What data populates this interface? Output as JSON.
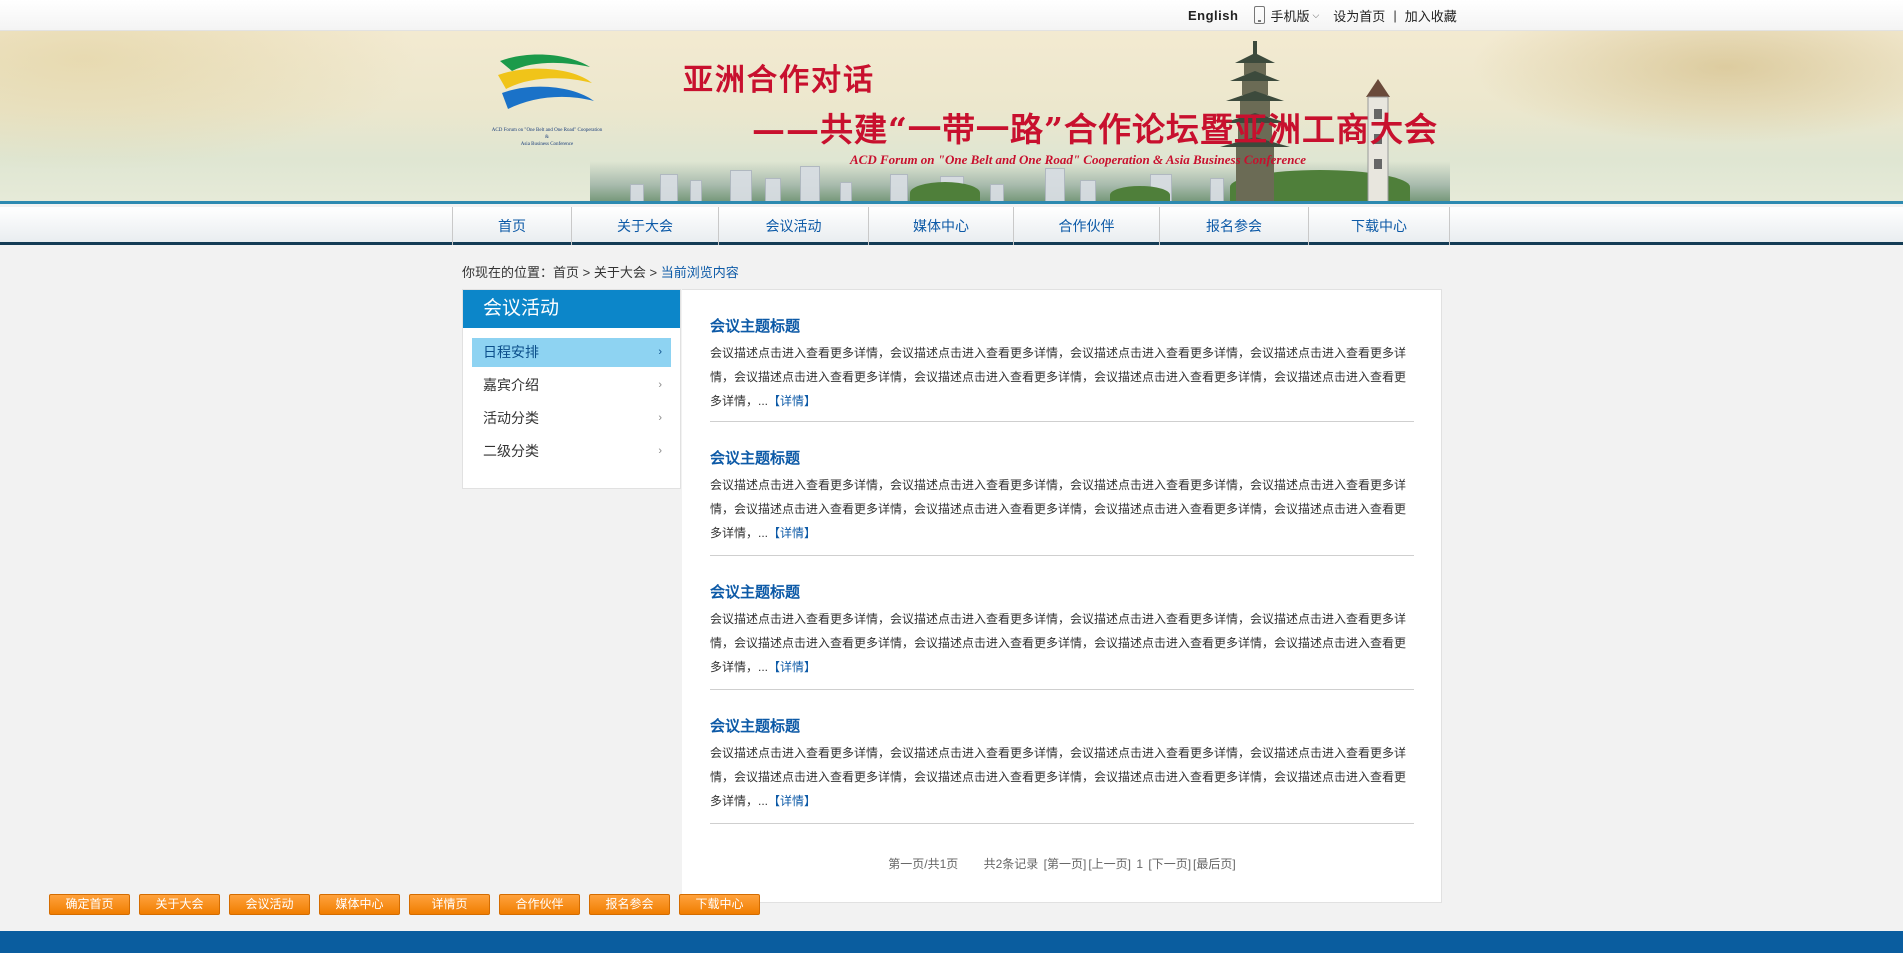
{
  "topbar": {
    "english": "English",
    "mobile": "手机版",
    "set_home": "设为首页",
    "separator": "|",
    "add_fav": "加入收藏"
  },
  "banner": {
    "logo_text_line1": "ACD Forum on \"One Belt and One Road\" Cooperation",
    "logo_text_line2": "&",
    "logo_text_line3": "Asia Business Conference",
    "title_cn_line1": "亚洲合作对话",
    "title_cn_line2": "——共建“一带一路”合作论坛暨亚洲工商大会",
    "title_en": "ACD Forum on \"One Belt and One Road\" Cooperation & Asia Business Conference"
  },
  "nav": {
    "items": [
      {
        "label": "首页"
      },
      {
        "label": "关于大会"
      },
      {
        "label": "会议活动"
      },
      {
        "label": "媒体中心"
      },
      {
        "label": "合作伙伴"
      },
      {
        "label": "报名参会"
      },
      {
        "label": "下载中心"
      }
    ]
  },
  "breadcrumb": {
    "prefix": "你现在的位置：",
    "home": "首页",
    "sep1": " > ",
    "parent": "关于大会",
    "sep2": " > ",
    "current": "当前浏览内容"
  },
  "sidebar": {
    "title": "会议活动",
    "items": [
      {
        "label": "日程安排"
      },
      {
        "label": "嘉宾介绍"
      },
      {
        "label": "活动分类"
      },
      {
        "label": "二级分类"
      }
    ]
  },
  "articles": [
    {
      "title": "会议主题标题",
      "desc": "会议描述点击进入查看更多详情，会议描述点击进入查看更多详情，会议描述点击进入查看更多详情，会议描述点击进入查看更多详情，会议描述点击进入查看更多详情，会议描述点击进入查看更多详情，会议描述点击进入查看更多详情，会议描述点击进入查看更多详情，...",
      "more": "【详情】"
    },
    {
      "title": "会议主题标题",
      "desc": "会议描述点击进入查看更多详情，会议描述点击进入查看更多详情，会议描述点击进入查看更多详情，会议描述点击进入查看更多详情，会议描述点击进入查看更多详情，会议描述点击进入查看更多详情，会议描述点击进入查看更多详情，会议描述点击进入查看更多详情，...",
      "more": "【详情】"
    },
    {
      "title": "会议主题标题",
      "desc": "会议描述点击进入查看更多详情，会议描述点击进入查看更多详情，会议描述点击进入查看更多详情，会议描述点击进入查看更多详情，会议描述点击进入查看更多详情，会议描述点击进入查看更多详情，会议描述点击进入查看更多详情，会议描述点击进入查看更多详情，...",
      "more": "【详情】"
    },
    {
      "title": "会议主题标题",
      "desc": "会议描述点击进入查看更多详情，会议描述点击进入查看更多详情，会议描述点击进入查看更多详情，会议描述点击进入查看更多详情，会议描述点击进入查看更多详情，会议描述点击进入查看更多详情，会议描述点击进入查看更多详情，会议描述点击进入查看更多详情，...",
      "more": "【详情】"
    }
  ],
  "pager": {
    "page_info": "第一页/共1页",
    "total": "共2条记录",
    "first": "[第一页]",
    "prev": "[上一页]",
    "current": "1",
    "next": "[下一页]",
    "last": "[最后页]"
  },
  "bottom_buttons": [
    {
      "label": "确定首页"
    },
    {
      "label": "关于大会"
    },
    {
      "label": "会议活动"
    },
    {
      "label": "媒体中心"
    },
    {
      "label": "详情页"
    },
    {
      "label": "合作伙伴"
    },
    {
      "label": "报名参会"
    },
    {
      "label": "下载中心"
    }
  ],
  "colors": {
    "brand_blue": "#0c86c9",
    "link_blue": "#0d5aa7",
    "title_red": "#c8102e",
    "button_orange": "#f07d00",
    "footer_blue": "#0a5d9f"
  }
}
